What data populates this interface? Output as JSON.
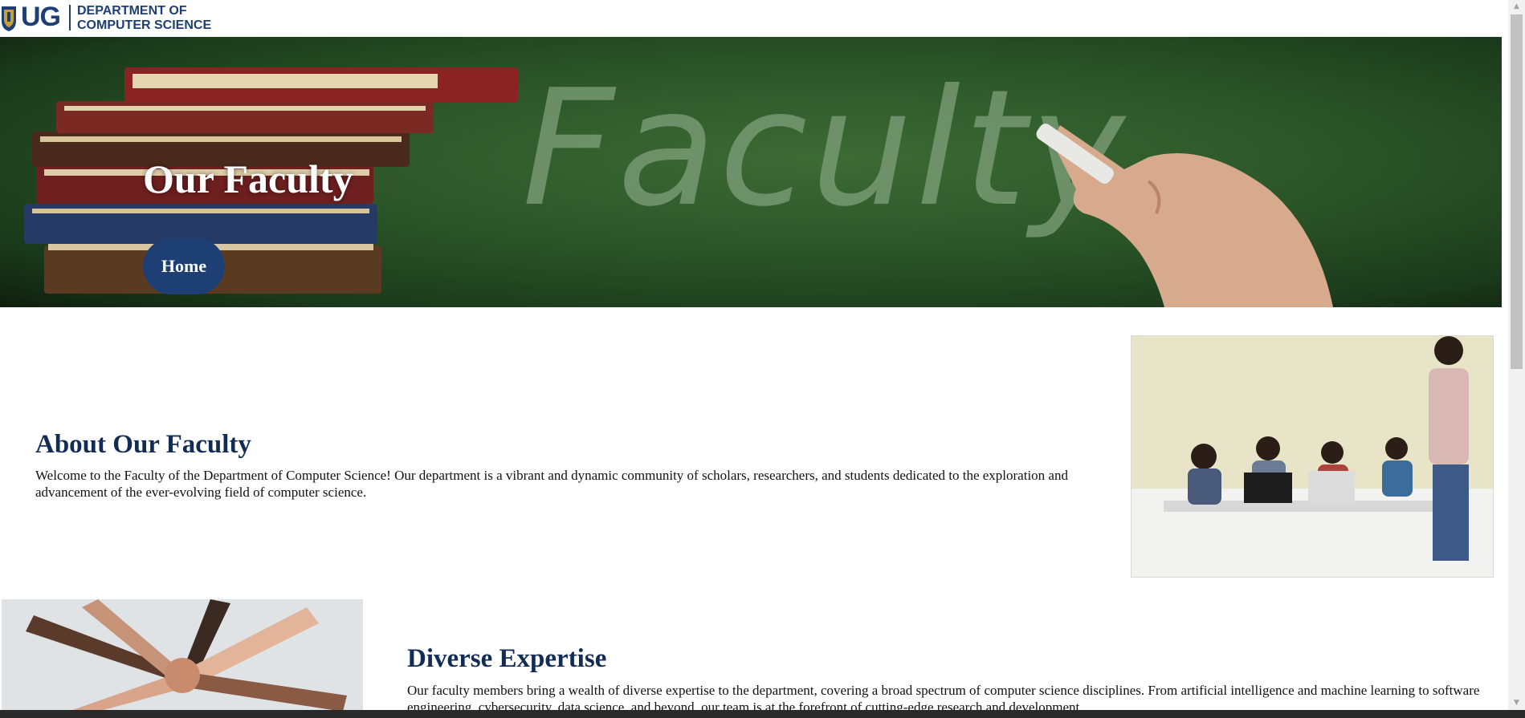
{
  "header": {
    "logo_ug": "UG",
    "logo_line1": "DEPARTMENT OF",
    "logo_line2": "COMPUTER SCIENCE"
  },
  "hero": {
    "title": "Our Faculty",
    "chalk_word": "Faculty",
    "home_button": "Home"
  },
  "about": {
    "title": "About Our Faculty",
    "text": "Welcome to the Faculty of the Department of Computer Science! Our department is a vibrant and dynamic community of scholars, researchers, and students dedicated to the exploration and advancement of the ever-evolving field of computer science."
  },
  "diverse": {
    "title": "Diverse Expertise",
    "text": "Our faculty members bring a wealth of diverse expertise to the department, covering a broad spectrum of computer science disciplines. From artificial intelligence and machine learning to software engineering, cybersecurity, data science, and beyond, our team is at the forefront of cutting-edge research and development."
  },
  "colors": {
    "brand_blue": "#1d3f73",
    "heading_navy": "#132c55",
    "hero_green": "#2b5528"
  },
  "icons": {
    "scroll_up": "▲",
    "scroll_down": "▼"
  }
}
